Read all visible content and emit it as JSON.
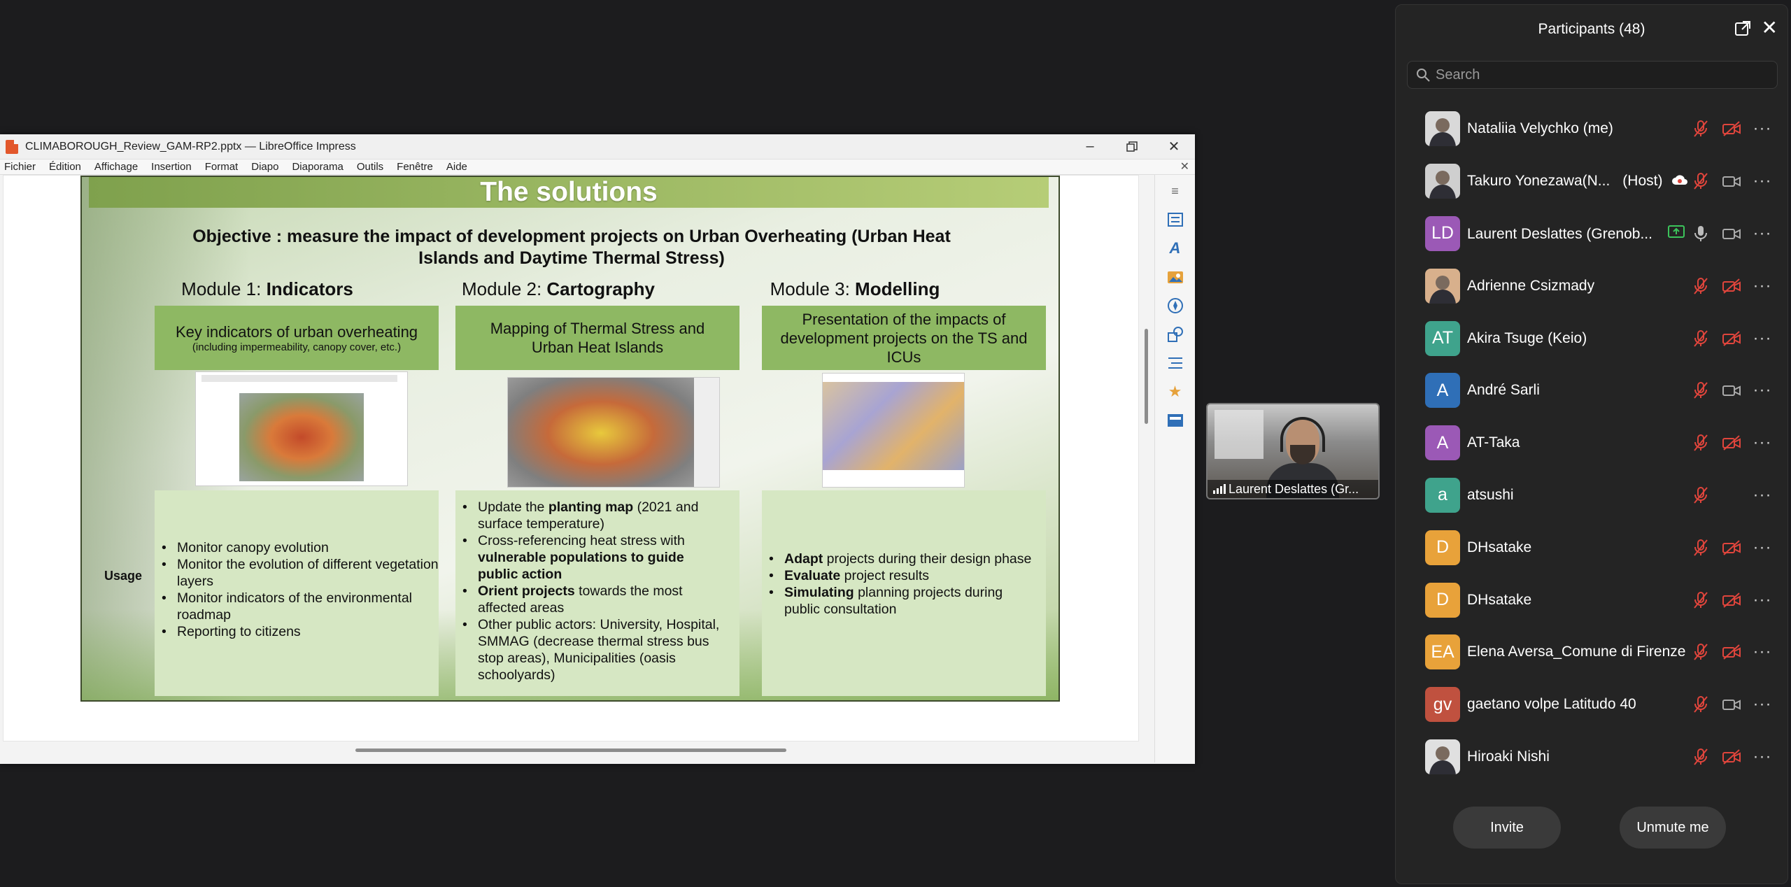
{
  "impress": {
    "window_title": "CLIMABOROUGH_Review_GAM-RP2.pptx — LibreOffice Impress",
    "menu": [
      "Fichier",
      "Édition",
      "Affichage",
      "Insertion",
      "Format",
      "Diapo",
      "Diaporama",
      "Outils",
      "Fenêtre",
      "Aide"
    ]
  },
  "slide": {
    "title": "The solutions",
    "objective": "Objective : measure the impact of development projects on Urban Overheating (Urban Heat Islands and Daytime Thermal Stress)",
    "modules": [
      {
        "prefix": "Module 1: ",
        "name": "Indicators",
        "box_main": "Key indicators of urban overheating",
        "box_sub": "(including impermeability, canopy cover, etc.)",
        "usage": [
          "Monitor canopy evolution",
          "Monitor the evolution of different vegetation layers",
          "Monitor indicators of the environmental roadmap",
          "Reporting to citizens"
        ]
      },
      {
        "prefix": "Module 2: ",
        "name": "Cartography",
        "box_main": "Mapping of Thermal Stress and Urban Heat Islands",
        "usage_rich": [
          {
            "pre": "Update the ",
            "bold": "planting map",
            "post": " (2021 and surface temperature)"
          },
          {
            "pre": "Cross-referencing heat stress with ",
            "bold": "vulnerable populations to guide public action",
            "post": ""
          },
          {
            "pre": "",
            "bold": "Orient projects",
            "post": " towards the most affected areas"
          },
          {
            "pre": "Other public actors: University, Hospital, SMMAG (decrease thermal stress bus stop areas), Municipalities (oasis schoolyards)",
            "bold": "",
            "post": ""
          }
        ]
      },
      {
        "prefix": "Module 3: ",
        "name": "Modelling",
        "box_main": "Presentation of the impacts of development projects on the TS and ICUs",
        "usage_rich": [
          {
            "pre": "",
            "bold": "Adapt",
            "post": " projects during their design phase"
          },
          {
            "pre": "",
            "bold": "Evaluate",
            "post": " project results"
          },
          {
            "pre": "",
            "bold": "Simulating",
            "post": " planning projects during public consultation"
          }
        ]
      }
    ],
    "usage_label": "Usage"
  },
  "video": {
    "name": "Laurent Deslattes (Gr..."
  },
  "participants_panel": {
    "title": "Participants (48)",
    "search_placeholder": "Search",
    "invite_label": "Invite",
    "unmute_label": "Unmute me",
    "items": [
      {
        "name": "Nataliia Velychko (me)",
        "avatar": "photo",
        "mic": "muted",
        "cam": "off"
      },
      {
        "name": "Takuro Yonezawa(N...",
        "role": "(Host)",
        "avatar": "photo",
        "badge": "cloud-record",
        "mic": "muted",
        "cam": "on"
      },
      {
        "name": "Laurent Deslattes (Grenob...",
        "initials": "LD",
        "avatar_color": "#9b59b6",
        "badge": "share-screen",
        "mic": "on",
        "cam": "on"
      },
      {
        "name": "Adrienne Csizmady",
        "avatar": "photo",
        "mic": "muted",
        "cam": "off"
      },
      {
        "name": "Akira Tsuge (Keio)",
        "initials": "AT",
        "avatar_color": "#3fa38c",
        "mic": "muted",
        "cam": "off"
      },
      {
        "name": "André Sarli",
        "initials": "A",
        "avatar_color": "#2f6fb7",
        "mic": "muted",
        "cam": "on"
      },
      {
        "name": "AT-Taka",
        "initials": "A",
        "avatar_color": "#9b59b6",
        "mic": "muted",
        "cam": "off"
      },
      {
        "name": "atsushi",
        "initials": "a",
        "avatar_color": "#3fa38c",
        "mic": "muted",
        "cam": "none"
      },
      {
        "name": "DHsatake",
        "initials": "D",
        "avatar_color": "#e8a23a",
        "mic": "muted",
        "cam": "off"
      },
      {
        "name": "DHsatake",
        "initials": "D",
        "avatar_color": "#e8a23a",
        "mic": "muted",
        "cam": "off"
      },
      {
        "name": "Elena Aversa_Comune di Firenze",
        "initials": "EA",
        "avatar_color": "#e8a23a",
        "mic": "muted",
        "cam": "off"
      },
      {
        "name": "gaetano volpe Latitudo 40",
        "initials": "gv",
        "avatar_color": "#c0513f",
        "mic": "muted",
        "cam": "on"
      },
      {
        "name": "Hiroaki Nishi",
        "avatar": "photo",
        "mic": "muted",
        "cam": "off"
      }
    ]
  },
  "colors": {
    "slide_green": "#8eb863",
    "usage_green": "#d6e7c3",
    "muted_red": "#e0453c",
    "panel_bg": "#242424"
  }
}
